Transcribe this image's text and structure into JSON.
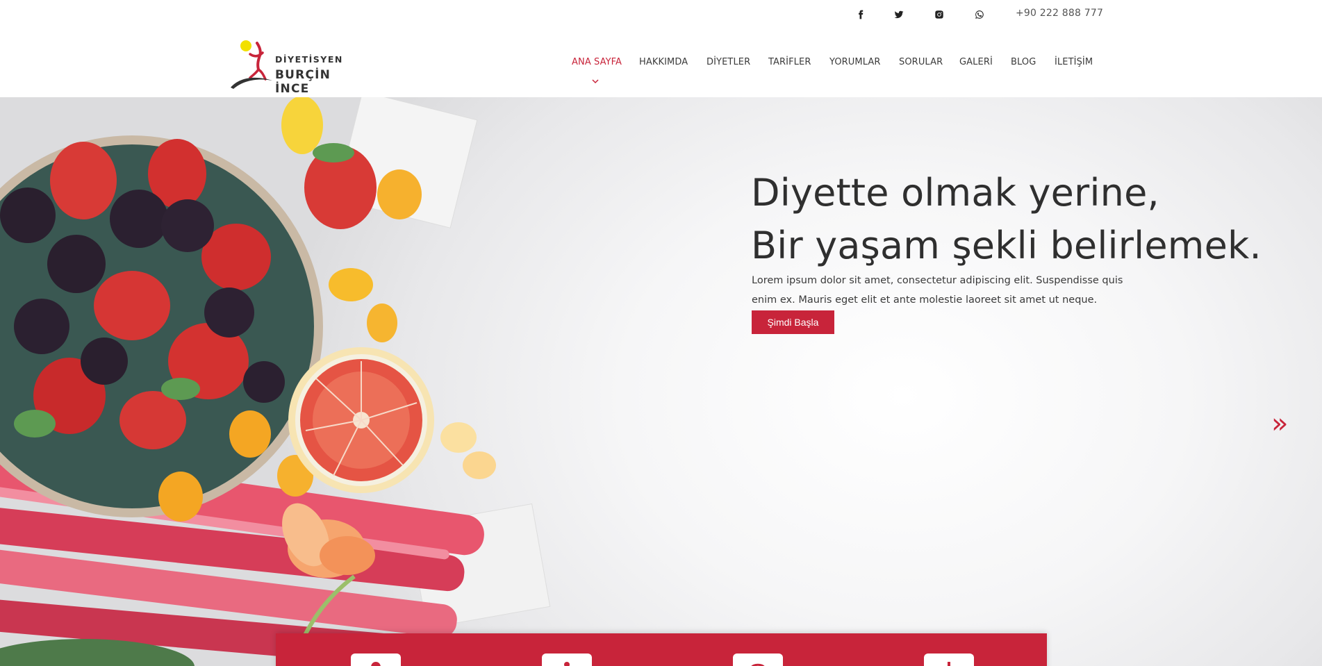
{
  "topbar": {
    "social": [
      {
        "name": "facebook-icon"
      },
      {
        "name": "twitter-icon"
      },
      {
        "name": "instagram-icon"
      },
      {
        "name": "whatsapp-icon"
      }
    ],
    "phone": "+90 222 888 777"
  },
  "logo": {
    "line1": "DİYETİSYEN",
    "line2": "BURÇİN İNCE",
    "dot_color": "#f2e000",
    "figure_color": "#c8243a"
  },
  "nav": {
    "items": [
      {
        "label": "ANA SAYFA",
        "active": true
      },
      {
        "label": "HAKKIMDA"
      },
      {
        "label": "DİYETLER"
      },
      {
        "label": "TARİFLER"
      },
      {
        "label": "YORUMLAR"
      },
      {
        "label": "SORULAR"
      },
      {
        "label": "GALERİ"
      },
      {
        "label": "BLOG"
      },
      {
        "label": "İLETİŞİM"
      }
    ]
  },
  "hero": {
    "title_line1": "Diyette olmak yerine,",
    "title_line2": "Bir yaşam şekli belirlemek.",
    "text": "Lorem ipsum dolor sit amet, consectetur adipiscing elit. Suspendisse quis enim ex. Mauris eget elit et ante molestie laoreet sit amet ut neque.",
    "button": "Şimdi Başla",
    "next_arrow": "»"
  },
  "theme": {
    "accent": "#c8243a",
    "text": "#2f2f2f"
  }
}
